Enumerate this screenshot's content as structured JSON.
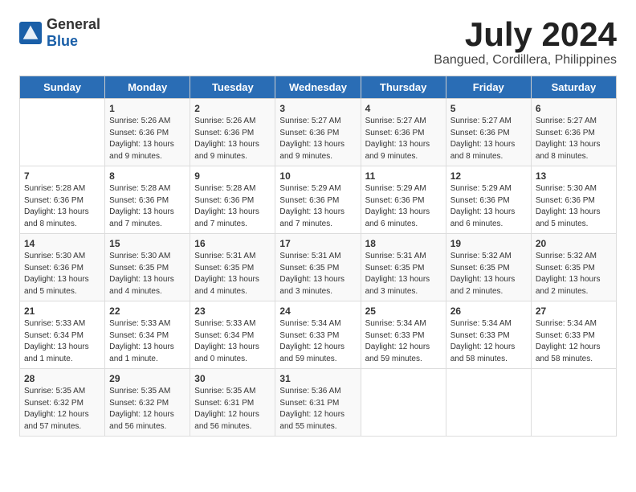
{
  "header": {
    "logo_general": "General",
    "logo_blue": "Blue",
    "month": "July 2024",
    "location": "Bangued, Cordillera, Philippines"
  },
  "days_of_week": [
    "Sunday",
    "Monday",
    "Tuesday",
    "Wednesday",
    "Thursday",
    "Friday",
    "Saturday"
  ],
  "weeks": [
    [
      {
        "day": "",
        "info": ""
      },
      {
        "day": "1",
        "info": "Sunrise: 5:26 AM\nSunset: 6:36 PM\nDaylight: 13 hours\nand 9 minutes."
      },
      {
        "day": "2",
        "info": "Sunrise: 5:26 AM\nSunset: 6:36 PM\nDaylight: 13 hours\nand 9 minutes."
      },
      {
        "day": "3",
        "info": "Sunrise: 5:27 AM\nSunset: 6:36 PM\nDaylight: 13 hours\nand 9 minutes."
      },
      {
        "day": "4",
        "info": "Sunrise: 5:27 AM\nSunset: 6:36 PM\nDaylight: 13 hours\nand 9 minutes."
      },
      {
        "day": "5",
        "info": "Sunrise: 5:27 AM\nSunset: 6:36 PM\nDaylight: 13 hours\nand 8 minutes."
      },
      {
        "day": "6",
        "info": "Sunrise: 5:27 AM\nSunset: 6:36 PM\nDaylight: 13 hours\nand 8 minutes."
      }
    ],
    [
      {
        "day": "7",
        "info": "Sunrise: 5:28 AM\nSunset: 6:36 PM\nDaylight: 13 hours\nand 8 minutes."
      },
      {
        "day": "8",
        "info": "Sunrise: 5:28 AM\nSunset: 6:36 PM\nDaylight: 13 hours\nand 7 minutes."
      },
      {
        "day": "9",
        "info": "Sunrise: 5:28 AM\nSunset: 6:36 PM\nDaylight: 13 hours\nand 7 minutes."
      },
      {
        "day": "10",
        "info": "Sunrise: 5:29 AM\nSunset: 6:36 PM\nDaylight: 13 hours\nand 7 minutes."
      },
      {
        "day": "11",
        "info": "Sunrise: 5:29 AM\nSunset: 6:36 PM\nDaylight: 13 hours\nand 6 minutes."
      },
      {
        "day": "12",
        "info": "Sunrise: 5:29 AM\nSunset: 6:36 PM\nDaylight: 13 hours\nand 6 minutes."
      },
      {
        "day": "13",
        "info": "Sunrise: 5:30 AM\nSunset: 6:36 PM\nDaylight: 13 hours\nand 5 minutes."
      }
    ],
    [
      {
        "day": "14",
        "info": "Sunrise: 5:30 AM\nSunset: 6:36 PM\nDaylight: 13 hours\nand 5 minutes."
      },
      {
        "day": "15",
        "info": "Sunrise: 5:30 AM\nSunset: 6:35 PM\nDaylight: 13 hours\nand 4 minutes."
      },
      {
        "day": "16",
        "info": "Sunrise: 5:31 AM\nSunset: 6:35 PM\nDaylight: 13 hours\nand 4 minutes."
      },
      {
        "day": "17",
        "info": "Sunrise: 5:31 AM\nSunset: 6:35 PM\nDaylight: 13 hours\nand 3 minutes."
      },
      {
        "day": "18",
        "info": "Sunrise: 5:31 AM\nSunset: 6:35 PM\nDaylight: 13 hours\nand 3 minutes."
      },
      {
        "day": "19",
        "info": "Sunrise: 5:32 AM\nSunset: 6:35 PM\nDaylight: 13 hours\nand 2 minutes."
      },
      {
        "day": "20",
        "info": "Sunrise: 5:32 AM\nSunset: 6:35 PM\nDaylight: 13 hours\nand 2 minutes."
      }
    ],
    [
      {
        "day": "21",
        "info": "Sunrise: 5:33 AM\nSunset: 6:34 PM\nDaylight: 13 hours\nand 1 minute."
      },
      {
        "day": "22",
        "info": "Sunrise: 5:33 AM\nSunset: 6:34 PM\nDaylight: 13 hours\nand 1 minute."
      },
      {
        "day": "23",
        "info": "Sunrise: 5:33 AM\nSunset: 6:34 PM\nDaylight: 13 hours\nand 0 minutes."
      },
      {
        "day": "24",
        "info": "Sunrise: 5:34 AM\nSunset: 6:33 PM\nDaylight: 12 hours\nand 59 minutes."
      },
      {
        "day": "25",
        "info": "Sunrise: 5:34 AM\nSunset: 6:33 PM\nDaylight: 12 hours\nand 59 minutes."
      },
      {
        "day": "26",
        "info": "Sunrise: 5:34 AM\nSunset: 6:33 PM\nDaylight: 12 hours\nand 58 minutes."
      },
      {
        "day": "27",
        "info": "Sunrise: 5:34 AM\nSunset: 6:33 PM\nDaylight: 12 hours\nand 58 minutes."
      }
    ],
    [
      {
        "day": "28",
        "info": "Sunrise: 5:35 AM\nSunset: 6:32 PM\nDaylight: 12 hours\nand 57 minutes."
      },
      {
        "day": "29",
        "info": "Sunrise: 5:35 AM\nSunset: 6:32 PM\nDaylight: 12 hours\nand 56 minutes."
      },
      {
        "day": "30",
        "info": "Sunrise: 5:35 AM\nSunset: 6:31 PM\nDaylight: 12 hours\nand 56 minutes."
      },
      {
        "day": "31",
        "info": "Sunrise: 5:36 AM\nSunset: 6:31 PM\nDaylight: 12 hours\nand 55 minutes."
      },
      {
        "day": "",
        "info": ""
      },
      {
        "day": "",
        "info": ""
      },
      {
        "day": "",
        "info": ""
      }
    ]
  ]
}
